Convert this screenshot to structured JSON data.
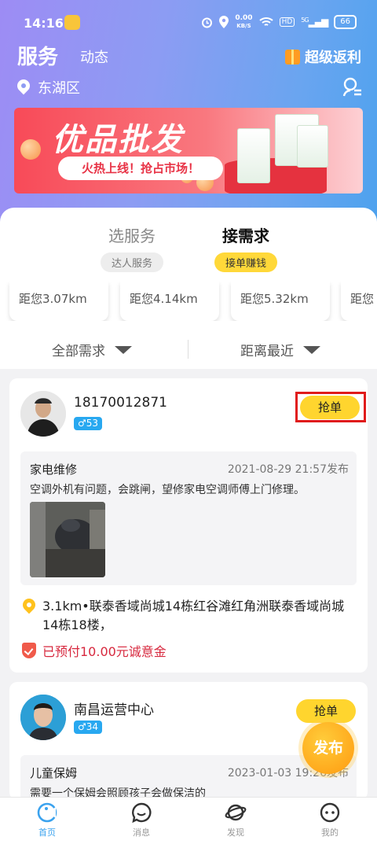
{
  "status_bar": {
    "time": "14:16",
    "net_speed_value": "0.00",
    "net_speed_unit": "KB/S",
    "hd": "HD",
    "signal": "5G",
    "battery": "66"
  },
  "header": {
    "title": "服务",
    "tab_feed": "动态",
    "rebate": "超级返利",
    "location": "东湖区"
  },
  "banner": {
    "title": "优品批发",
    "subtitle": "火热上线！抢占市场！"
  },
  "mode_tabs": [
    {
      "label": "选服务",
      "pill": "达人服务"
    },
    {
      "label": "接需求",
      "pill": "接单赚钱"
    }
  ],
  "distances": [
    "距您3.07km",
    "距您4.14km",
    "距您5.32km",
    "距您"
  ],
  "filters": {
    "all": "全部需求",
    "sort": "距离最近"
  },
  "posts": [
    {
      "user": "18170012871",
      "gender_age": "♂53",
      "grab": "抢单",
      "category": "家电维修",
      "date": "2021-08-29 21:57发布",
      "description": "空调外机有问题，会跳闸，望修家电空调师傅上门修理。",
      "location": "3.1km•联泰香域尚城14栋红谷滩红角洲联泰香域尚城14栋18楼，",
      "paid": "已预付10.00元诚意金"
    },
    {
      "user": "南昌运营中心",
      "gender_age": "♂34",
      "grab": "抢单",
      "category": "儿童保姆",
      "date": "2023-01-03 19:26发布",
      "description": "需要一个保姆会照顾孩子会做保洁的"
    }
  ],
  "fab": "发布",
  "tabbar": [
    {
      "label": "首页",
      "icon": "home-icon"
    },
    {
      "label": "消息",
      "icon": "message-icon"
    },
    {
      "label": "发现",
      "icon": "planet-icon"
    },
    {
      "label": "我的",
      "icon": "profile-icon"
    }
  ],
  "colors": {
    "accent_yellow": "#ffd52e",
    "active_tab": "#3aa2ee",
    "warning_red": "#d7283e"
  }
}
